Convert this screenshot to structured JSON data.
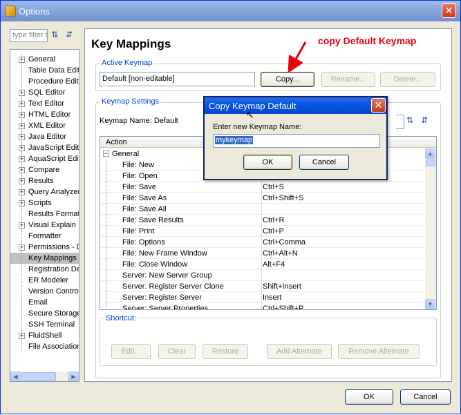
{
  "window": {
    "title": "Options",
    "filter_placeholder": "type filter text",
    "buttons": {
      "ok": "OK",
      "cancel": "Cancel"
    }
  },
  "tree": {
    "items": [
      {
        "label": "General",
        "expandable": true
      },
      {
        "label": "Table Data Editor",
        "expandable": false
      },
      {
        "label": "Procedure Editor",
        "expandable": false
      },
      {
        "label": "SQL Editor",
        "expandable": true
      },
      {
        "label": "Text Editor",
        "expandable": true
      },
      {
        "label": "HTML Editor",
        "expandable": true
      },
      {
        "label": "XML Editor",
        "expandable": true
      },
      {
        "label": "Java Editor",
        "expandable": true
      },
      {
        "label": "JavaScript Editor",
        "expandable": true
      },
      {
        "label": "AquaScript Editor",
        "expandable": true
      },
      {
        "label": "Compare",
        "expandable": true
      },
      {
        "label": "Results",
        "expandable": true
      },
      {
        "label": "Query Analyzer",
        "expandable": true
      },
      {
        "label": "Scripts",
        "expandable": true
      },
      {
        "label": "Results Format",
        "expandable": false
      },
      {
        "label": "Visual Explain",
        "expandable": true
      },
      {
        "label": "Formatter",
        "expandable": false
      },
      {
        "label": "Permissions - De",
        "expandable": true
      },
      {
        "label": "Key Mappings",
        "expandable": false,
        "selected": true
      },
      {
        "label": "Registration De",
        "expandable": false
      },
      {
        "label": "ER Modeler",
        "expandable": false
      },
      {
        "label": "Version Control",
        "expandable": false
      },
      {
        "label": "Email",
        "expandable": false
      },
      {
        "label": "Secure Storage",
        "expandable": false
      },
      {
        "label": "SSH Terminal",
        "expandable": false
      },
      {
        "label": "FluidShell",
        "expandable": true
      },
      {
        "label": "File Associations",
        "expandable": false
      }
    ]
  },
  "main": {
    "heading": "Key Mappings",
    "annotation": "copy Default Keymap",
    "active_keymap": {
      "label": "Active Keymap",
      "value": "Default [non-editable]",
      "copy": "Copy...",
      "rename": "Rename...",
      "delete": "Delete..."
    },
    "keymap_settings": {
      "label": "Keymap Settings",
      "name_label": "Keymap Name: Default",
      "column_action": "Action",
      "group": "General",
      "rows": [
        {
          "action": "File: New",
          "key": ""
        },
        {
          "action": "File: Open",
          "key": ""
        },
        {
          "action": "File: Save",
          "key": "Ctrl+S"
        },
        {
          "action": "File: Save As",
          "key": "Ctrl+Shift+S"
        },
        {
          "action": "File: Save All",
          "key": ""
        },
        {
          "action": "File: Save Results",
          "key": "Ctrl+R"
        },
        {
          "action": "File: Print",
          "key": "Ctrl+P"
        },
        {
          "action": "File: Options",
          "key": "Ctrl+Comma"
        },
        {
          "action": "File: New Frame Window",
          "key": "Ctrl+Alt+N"
        },
        {
          "action": "File: Close Window",
          "key": "Alt+F4"
        },
        {
          "action": "Server: New Server Group",
          "key": ""
        },
        {
          "action": "Server: Register Server Clone",
          "key": "Shift+Insert"
        },
        {
          "action": "Server: Register Server",
          "key": "Insert"
        },
        {
          "action": "Server: Server Properties",
          "key": "Ctrl+Shift+P"
        }
      ]
    },
    "shortcut": {
      "label": "Shortcut:",
      "edit": "Edit...",
      "clear": "Clear",
      "restore": "Restore",
      "add_alternate": "Add Alternate",
      "remove_alternate": "Remove Alternate"
    }
  },
  "dialog": {
    "title": "Copy Keymap Default",
    "prompt": "Enter new Keymap Name:",
    "value": "mykeymap",
    "ok": "OK",
    "cancel": "Cancel"
  },
  "colors": {
    "annotation_red": "#e8000f",
    "titlebar_blue": "#0a246a",
    "selection_gray": "#c0c0c0"
  }
}
